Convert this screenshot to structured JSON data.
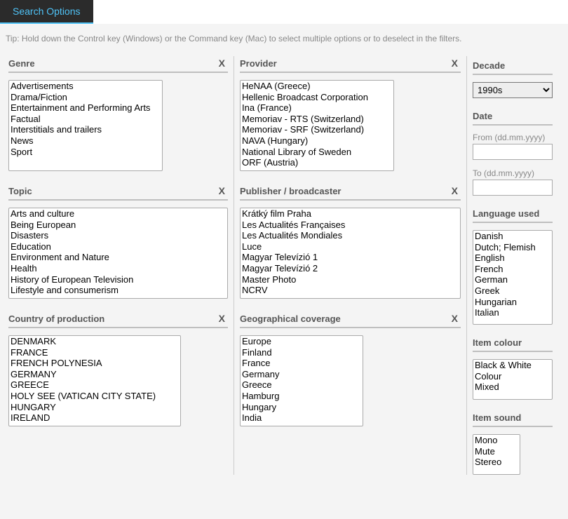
{
  "tab_label": "Search Options",
  "tip_text": "Tip: Hold down the Control key (Windows) or the Command key (Mac) to select multiple options or to deselect in the filters.",
  "clear_glyph": "X",
  "filters": {
    "genre": {
      "title": "Genre",
      "options": [
        "Advertisements",
        "Drama/Fiction",
        "Entertainment and Performing Arts",
        "Factual",
        "Interstitials and trailers",
        "News",
        "Sport"
      ]
    },
    "provider": {
      "title": "Provider",
      "options": [
        "HeNAA (Greece)",
        "Hellenic Broadcast Corporation",
        "Ina (France)",
        "Memoriav - RTS (Switzerland)",
        "Memoriav - SRF (Switzerland)",
        "NAVA (Hungary)",
        "National Library of Sweden",
        "ORF (Austria)"
      ]
    },
    "topic": {
      "title": "Topic",
      "options": [
        "Arts and culture",
        "Being European",
        "Disasters",
        "Education",
        "Environment and Nature",
        "Health",
        "History of European Television",
        "Lifestyle and consumerism"
      ]
    },
    "publisher": {
      "title": "Publisher / broadcaster",
      "options": [
        "Krátký film Praha",
        "Les Actualités Françaises",
        "Les Actualités Mondiales",
        "Luce",
        "Magyar Televízió 1",
        "Magyar Televízió 2",
        "Master Photo",
        "NCRV"
      ]
    },
    "country": {
      "title": "Country of production",
      "options": [
        "DENMARK",
        "FRANCE",
        "FRENCH POLYNESIA",
        "GERMANY",
        "GREECE",
        "HOLY SEE (VATICAN CITY STATE)",
        "HUNGARY",
        "IRELAND"
      ]
    },
    "geo": {
      "title": "Geographical coverage",
      "options": [
        "Europe",
        "Finland",
        "France",
        "Germany",
        "Greece",
        "Hamburg",
        "Hungary",
        "India"
      ]
    }
  },
  "decade": {
    "title": "Decade",
    "selected": "1990s"
  },
  "date": {
    "title": "Date",
    "from_label": "From (dd.mm.yyyy)",
    "to_label": "To (dd.mm.yyyy)"
  },
  "language": {
    "title": "Language used",
    "options": [
      "Danish",
      "Dutch; Flemish",
      "English",
      "French",
      "German",
      "Greek",
      "Hungarian",
      "Italian"
    ]
  },
  "colour": {
    "title": "Item colour",
    "options": [
      "Black & White",
      "Colour",
      "Mixed"
    ]
  },
  "sound": {
    "title": "Item sound",
    "options": [
      "Mono",
      "Mute",
      "Stereo"
    ]
  }
}
